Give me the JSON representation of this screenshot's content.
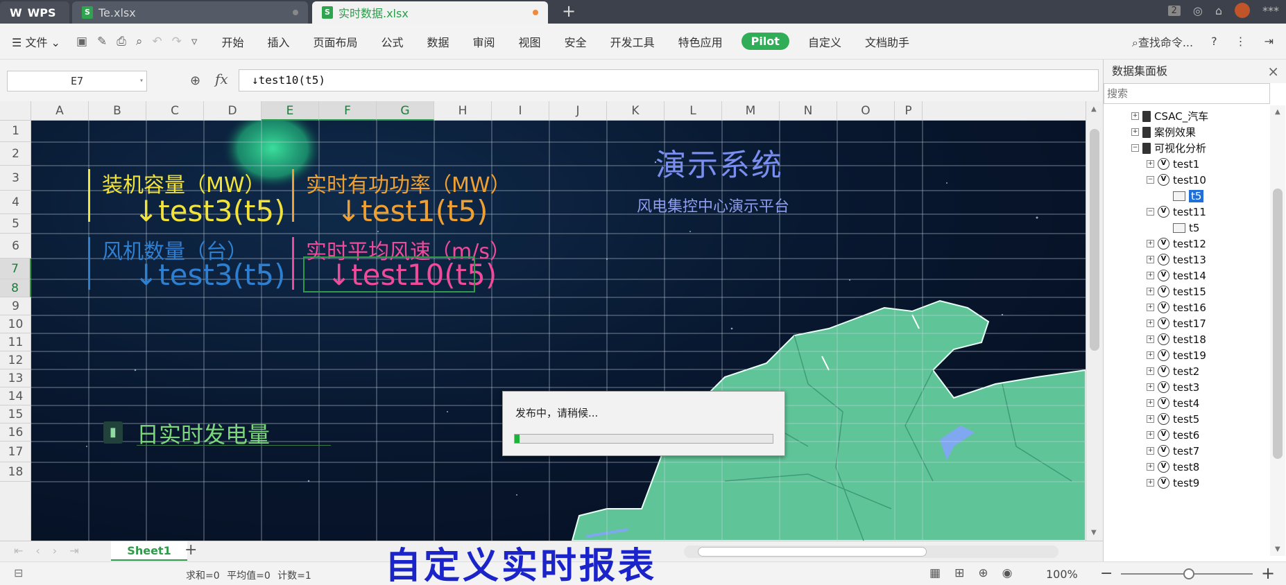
{
  "tabs": [
    {
      "label": "WPS"
    },
    {
      "label": "Te.xlsx"
    },
    {
      "label": "实时数据.xlsx"
    }
  ],
  "tabbar_right": {
    "badge": "2",
    "user": "***"
  },
  "menu": {
    "file": "文件",
    "items": [
      "开始",
      "插入",
      "页面布局",
      "公式",
      "数据",
      "审阅",
      "视图",
      "安全",
      "开发工具",
      "特色应用",
      "Pilot",
      "自定义",
      "文档助手"
    ],
    "search_cmd": "查找命令...",
    "help": "?"
  },
  "formula_bar": {
    "cell_ref": "E7",
    "fx": "fx",
    "formula": "↓test10(t5)"
  },
  "columns": [
    "A",
    "B",
    "C",
    "D",
    "E",
    "F",
    "G",
    "H",
    "I",
    "J",
    "K",
    "L",
    "M",
    "N",
    "O",
    "P"
  ],
  "rows": [
    "1",
    "2",
    "3",
    "4",
    "5",
    "6",
    "7",
    "8",
    "9",
    "10",
    "11",
    "12",
    "13",
    "14",
    "15",
    "16",
    "17",
    "18"
  ],
  "dashboard": {
    "title": "演示系统",
    "subtitle": "风电集控中心演示平台",
    "kpi1_label": "装机容量（MW）",
    "kpi1_value": "↓test3(t5)",
    "kpi2_label": "实时有功功率（MW）",
    "kpi2_value": "↓test1(t5)",
    "kpi3_label": "风机数量（台）",
    "kpi3_value": "↓test3(t5)",
    "kpi4_label": "实时平均风速（m/s）",
    "kpi4_value": "↓test10(t5)",
    "daily_label": "日实时发电量"
  },
  "dialog": {
    "message": "发布中，请稍候...",
    "progress": 0.02
  },
  "sheet": {
    "name": "Sheet1"
  },
  "status": {
    "summary": "求和=0  平均值=0  计数=1",
    "zoom": "100%"
  },
  "caption": "自定义实时报表",
  "panel": {
    "title": "数据集面板",
    "search_placeholder": "搜索",
    "tree": [
      {
        "label": "CSAC_汽车",
        "level": 0,
        "type": "folder",
        "toggle": "+"
      },
      {
        "label": "案例效果",
        "level": 0,
        "type": "folder",
        "toggle": "+"
      },
      {
        "label": "可视化分析",
        "level": 0,
        "type": "folder",
        "toggle": "-"
      },
      {
        "label": "test1",
        "level": 1,
        "type": "query",
        "toggle": "+"
      },
      {
        "label": "test10",
        "level": 1,
        "type": "query",
        "toggle": "-"
      },
      {
        "label": "t5",
        "level": 2,
        "type": "table",
        "toggle": "",
        "selected": true
      },
      {
        "label": "test11",
        "level": 1,
        "type": "query",
        "toggle": "-"
      },
      {
        "label": "t5",
        "level": 2,
        "type": "table",
        "toggle": ""
      },
      {
        "label": "test12",
        "level": 1,
        "type": "query",
        "toggle": "+"
      },
      {
        "label": "test13",
        "level": 1,
        "type": "query",
        "toggle": "+"
      },
      {
        "label": "test14",
        "level": 1,
        "type": "query",
        "toggle": "+"
      },
      {
        "label": "test15",
        "level": 1,
        "type": "query",
        "toggle": "+"
      },
      {
        "label": "test16",
        "level": 1,
        "type": "query",
        "toggle": "+"
      },
      {
        "label": "test17",
        "level": 1,
        "type": "query",
        "toggle": "+"
      },
      {
        "label": "test18",
        "level": 1,
        "type": "query",
        "toggle": "+"
      },
      {
        "label": "test19",
        "level": 1,
        "type": "query",
        "toggle": "+"
      },
      {
        "label": "test2",
        "level": 1,
        "type": "query",
        "toggle": "+"
      },
      {
        "label": "test3",
        "level": 1,
        "type": "query",
        "toggle": "+"
      },
      {
        "label": "test4",
        "level": 1,
        "type": "query",
        "toggle": "+"
      },
      {
        "label": "test5",
        "level": 1,
        "type": "query",
        "toggle": "+"
      },
      {
        "label": "test6",
        "level": 1,
        "type": "query",
        "toggle": "+"
      },
      {
        "label": "test7",
        "level": 1,
        "type": "query",
        "toggle": "+"
      },
      {
        "label": "test8",
        "level": 1,
        "type": "query",
        "toggle": "+"
      },
      {
        "label": "test9",
        "level": 1,
        "type": "query",
        "toggle": "+"
      }
    ]
  },
  "colors": {
    "accent": "#2fae57",
    "selection": "#2e9a4a",
    "caption": "#1a24c8",
    "yellow": "#f2e33a",
    "orange": "#f0a030",
    "blue": "#2f7fd0",
    "pink": "#f04a9a"
  }
}
